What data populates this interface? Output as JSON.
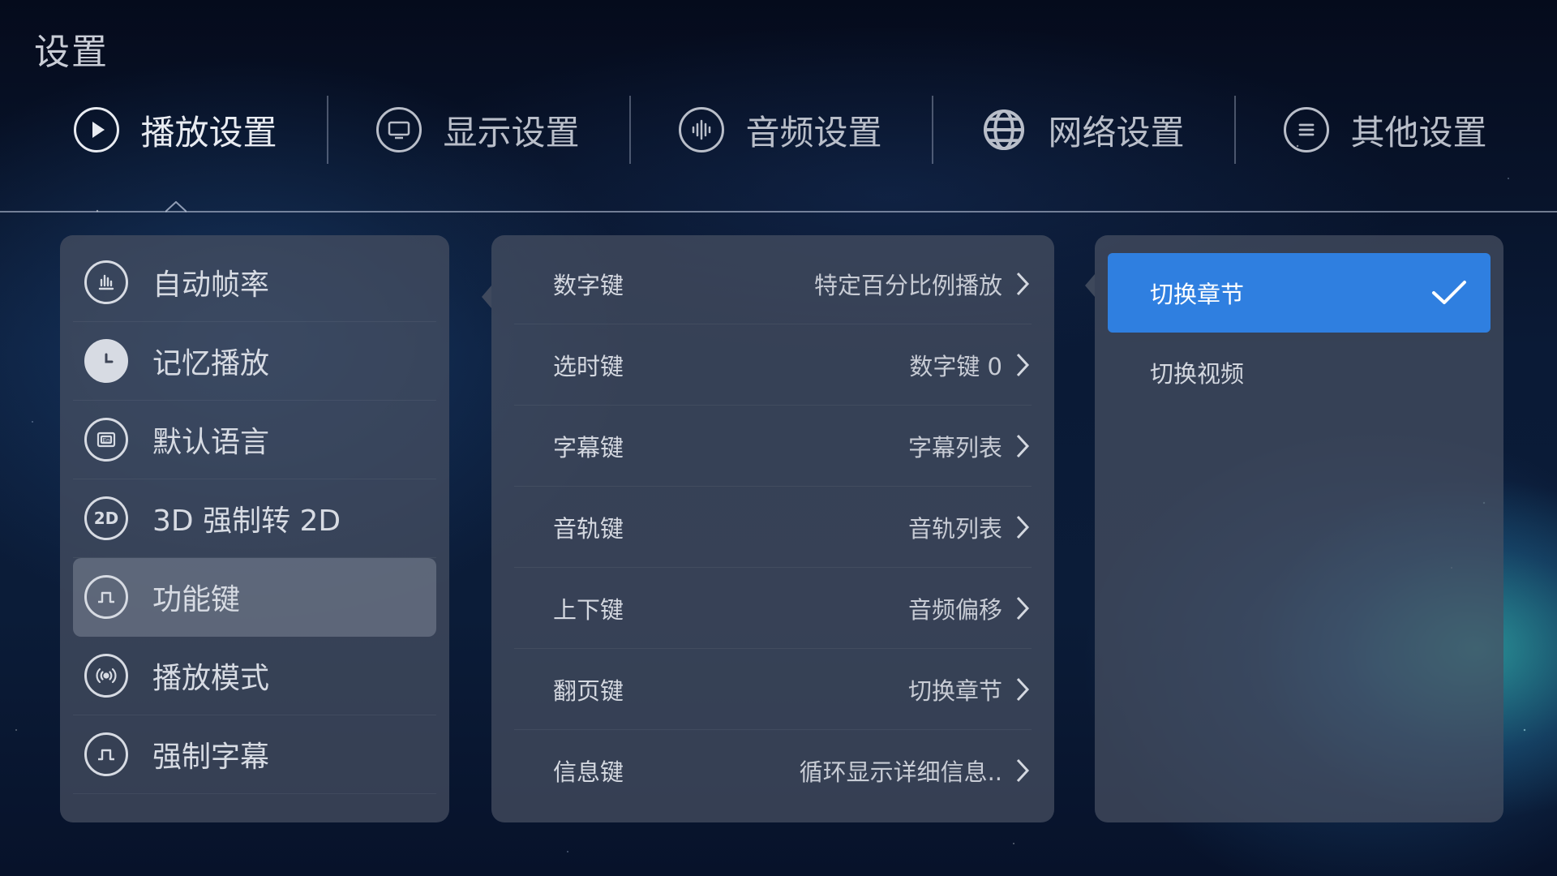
{
  "page_title": "设置",
  "tabs": [
    {
      "label": "播放设置",
      "icon": "play-icon",
      "active": true
    },
    {
      "label": "显示设置",
      "icon": "monitor-icon",
      "active": false
    },
    {
      "label": "音频设置",
      "icon": "audio-wave-icon",
      "active": false
    },
    {
      "label": "网络设置",
      "icon": "globe-icon",
      "active": false
    },
    {
      "label": "其他设置",
      "icon": "menu-lines-icon",
      "active": false
    }
  ],
  "left_menu": [
    {
      "label": "自动帧率",
      "icon": "bar-chart-icon",
      "selected": false
    },
    {
      "label": "记忆播放",
      "icon": "clock-icon",
      "selected": false
    },
    {
      "label": "默认语言",
      "icon": "language-en-icon",
      "selected": false
    },
    {
      "label": "3D 强制转 2D",
      "icon": "2d-badge-icon",
      "icon_text": "2D",
      "selected": false
    },
    {
      "label": "功能键",
      "icon": "square-wave-icon",
      "selected": true
    },
    {
      "label": "播放模式",
      "icon": "broadcast-icon",
      "selected": false
    },
    {
      "label": "强制字幕",
      "icon": "square-wave-icon",
      "selected": false
    }
  ],
  "function_keys": [
    {
      "key": "数字键",
      "value": "特定百分比例播放"
    },
    {
      "key": "选时键",
      "value": "数字键 0"
    },
    {
      "key": "字幕键",
      "value": "字幕列表"
    },
    {
      "key": "音轨键",
      "value": "音轨列表"
    },
    {
      "key": "上下键",
      "value": "音频偏移"
    },
    {
      "key": "翻页键",
      "value": "切换章节"
    },
    {
      "key": "信息键",
      "value": "循环显示详细信息.."
    }
  ],
  "options": [
    {
      "label": "切换章节",
      "selected": true
    },
    {
      "label": "切换视频",
      "selected": false
    }
  ],
  "colors": {
    "accent": "#2f7fe0",
    "panel": "#485062",
    "text": "#d4d8e0"
  }
}
